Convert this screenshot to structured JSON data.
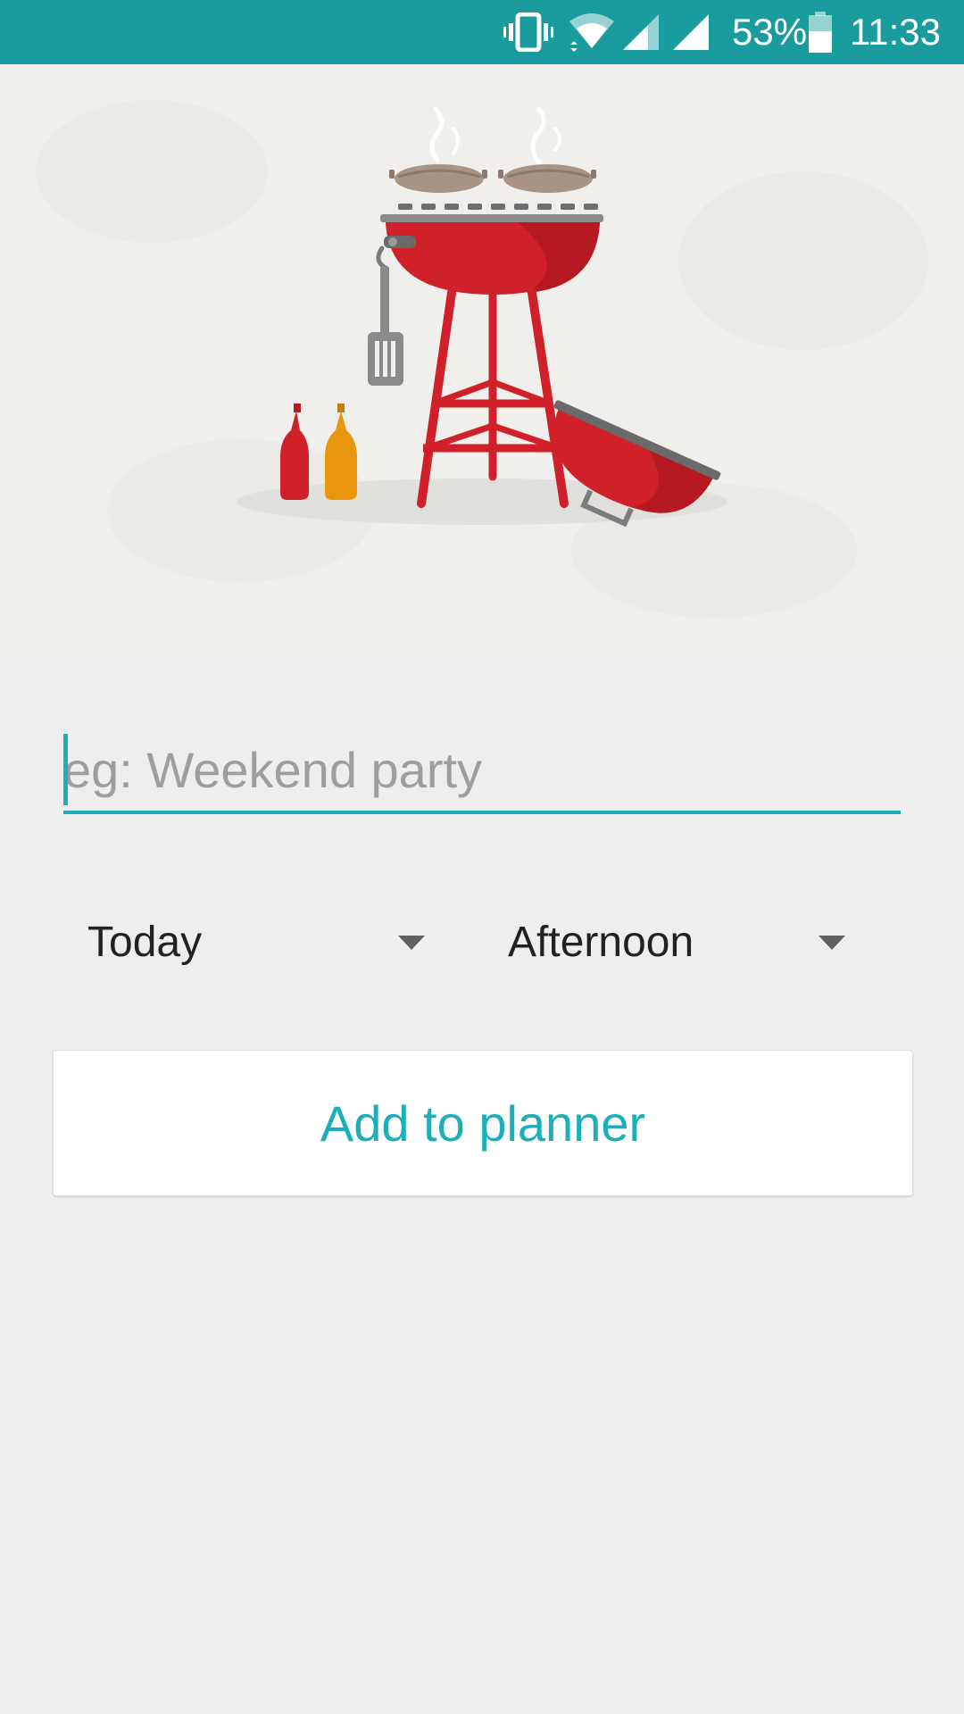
{
  "status_bar": {
    "battery_percent": "53%",
    "time": "11:33",
    "icons": [
      "vibrate-icon",
      "wifi-icon",
      "signal-icon",
      "signal-icon",
      "battery-icon"
    ],
    "background_color": "#1a9b9e"
  },
  "hero": {
    "image": "barbecue-grill-illustration"
  },
  "form": {
    "title_placeholder": "eg: Weekend party",
    "title_value": "",
    "day_selected": "Today",
    "time_selected": "Afternoon",
    "add_button_label": "Add to planner"
  },
  "colors": {
    "accent": "#1aafba",
    "background": "#eeeeee",
    "grill_red": "#d0202a"
  }
}
